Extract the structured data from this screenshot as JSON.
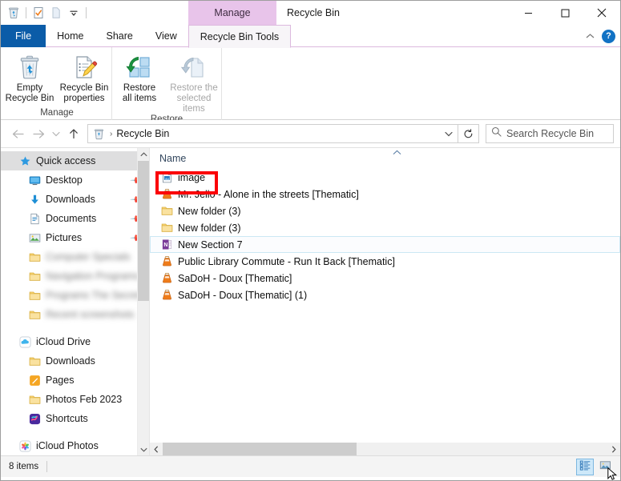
{
  "window": {
    "title": "Recycle Bin",
    "contextual_tab_header": "Manage",
    "minimize_label": "─",
    "maximize_label": "☐",
    "close_label": "✕",
    "help_label": "?",
    "collapse_ribbon_label": "⌃"
  },
  "quick_access_toolbar": {
    "items": [
      {
        "icon": "recycle-bin-icon",
        "name": "recycle-bin-properties"
      },
      {
        "icon": "checklist-icon",
        "name": "properties"
      },
      {
        "icon": "document-icon",
        "name": "new-item"
      },
      {
        "icon": "chevron-down-icon",
        "name": "customize-quick-access-toolbar"
      }
    ]
  },
  "ribbon": {
    "tabs": [
      {
        "label": "File",
        "id": "file",
        "state": "file"
      },
      {
        "label": "Home",
        "id": "home",
        "state": "normal"
      },
      {
        "label": "Share",
        "id": "share",
        "state": "normal"
      },
      {
        "label": "View",
        "id": "view",
        "state": "normal"
      },
      {
        "label": "Recycle Bin Tools",
        "id": "recycle-bin-tools",
        "state": "active"
      }
    ],
    "groups": [
      {
        "label": "Manage",
        "id": "manage",
        "buttons": [
          {
            "label_line1": "Empty",
            "label_line2": "Recycle Bin",
            "icon": "empty-recycle-bin-icon",
            "enabled": true
          },
          {
            "label_line1": "Recycle Bin",
            "label_line2": "properties",
            "icon": "recycle-bin-properties-icon",
            "enabled": true
          }
        ]
      },
      {
        "label": "Restore",
        "id": "restore",
        "buttons": [
          {
            "label_line1": "Restore",
            "label_line2": "all items",
            "icon": "restore-all-items-icon",
            "enabled": true
          },
          {
            "label_line1": "Restore the",
            "label_line2": "selected items",
            "icon": "restore-selected-items-icon",
            "enabled": false
          }
        ]
      }
    ]
  },
  "address_bar": {
    "back_label": "←",
    "forward_label": "→",
    "recent_label": "⌄",
    "up_label": "↑",
    "breadcrumb_icon": "recycle-bin-icon",
    "breadcrumb_separator": "›",
    "breadcrumb_text": "Recycle Bin",
    "dropdown_label": "⌄",
    "refresh_label": "↻",
    "search_placeholder": "Search Recycle Bin",
    "search_value": "",
    "search_icon": "search-icon"
  },
  "navigation_pane": {
    "items": [
      {
        "label": "Quick access",
        "icon": "star-icon",
        "indent": 0,
        "selected": true,
        "pinned": false,
        "blurred": false
      },
      {
        "label": "Desktop",
        "icon": "desktop-icon",
        "indent": 1,
        "selected": false,
        "pinned": true,
        "blurred": false
      },
      {
        "label": "Downloads",
        "icon": "downloads-icon",
        "indent": 1,
        "selected": false,
        "pinned": true,
        "blurred": false
      },
      {
        "label": "Documents",
        "icon": "documents-icon",
        "indent": 1,
        "selected": false,
        "pinned": true,
        "blurred": false
      },
      {
        "label": "Pictures",
        "icon": "pictures-icon",
        "indent": 1,
        "selected": false,
        "pinned": true,
        "blurred": false
      },
      {
        "label": "Computer Specials",
        "icon": "folder-icon",
        "indent": 1,
        "selected": false,
        "pinned": false,
        "blurred": true
      },
      {
        "label": "Navigation Programs",
        "icon": "folder-icon",
        "indent": 1,
        "selected": false,
        "pinned": false,
        "blurred": true
      },
      {
        "label": "Programs The Secret",
        "icon": "folder-icon",
        "indent": 1,
        "selected": false,
        "pinned": false,
        "blurred": true
      },
      {
        "label": "Recent screenshots",
        "icon": "folder-icon",
        "indent": 1,
        "selected": false,
        "pinned": false,
        "blurred": true
      },
      {
        "label": "iCloud Drive",
        "icon": "icloud-drive-icon",
        "indent": 0,
        "selected": false,
        "pinned": false,
        "blurred": false
      },
      {
        "label": "Downloads",
        "icon": "folder-icon",
        "indent": 1,
        "selected": false,
        "pinned": false,
        "blurred": false
      },
      {
        "label": "Pages",
        "icon": "pages-icon",
        "indent": 1,
        "selected": false,
        "pinned": false,
        "blurred": false
      },
      {
        "label": "Photos Feb 2023",
        "icon": "folder-icon",
        "indent": 1,
        "selected": false,
        "pinned": false,
        "blurred": false
      },
      {
        "label": "Shortcuts",
        "icon": "shortcuts-icon",
        "indent": 1,
        "selected": false,
        "pinned": false,
        "blurred": false
      },
      {
        "label": "iCloud Photos",
        "icon": "icloud-photos-icon",
        "indent": 0,
        "selected": false,
        "pinned": false,
        "blurred": false
      }
    ],
    "scroll_up_label": "⌃",
    "scroll_down_label": "⌄"
  },
  "file_list": {
    "columns": [
      {
        "label": "Name",
        "sort": "ascending",
        "sort_caret": "⌃"
      }
    ],
    "rows": [
      {
        "name": "image",
        "icon": "image-file-icon",
        "highlighted": true,
        "focused": false
      },
      {
        "name": "Mr. Jello - Alone in the streets [Thematic]",
        "icon": "vlc-media-icon",
        "highlighted": false,
        "focused": false
      },
      {
        "name": "New folder (3)",
        "icon": "folder-icon",
        "highlighted": false,
        "focused": false
      },
      {
        "name": "New folder (3)",
        "icon": "folder-icon",
        "highlighted": false,
        "focused": false
      },
      {
        "name": "New Section 7",
        "icon": "onenote-icon",
        "highlighted": false,
        "focused": true
      },
      {
        "name": "Public Library Commute - Run It Back [Thematic]",
        "icon": "vlc-media-icon",
        "highlighted": false,
        "focused": false
      },
      {
        "name": "SaDoH - Doux [Thematic]",
        "icon": "vlc-media-icon",
        "highlighted": false,
        "focused": false
      },
      {
        "name": "SaDoH - Doux [Thematic] (1)",
        "icon": "vlc-media-icon",
        "highlighted": false,
        "focused": false
      }
    ],
    "scroll_left_label": "‹",
    "scroll_right_label": "›"
  },
  "status_bar": {
    "item_count_text": "8 items",
    "view_buttons": [
      {
        "name": "details-view",
        "icon": "details-view-icon",
        "active": true
      },
      {
        "name": "large-icons-view",
        "icon": "large-icons-view-icon",
        "active": false
      }
    ]
  },
  "annotation": {
    "highlight_color": "#fb0007",
    "highlight_target": "image"
  }
}
